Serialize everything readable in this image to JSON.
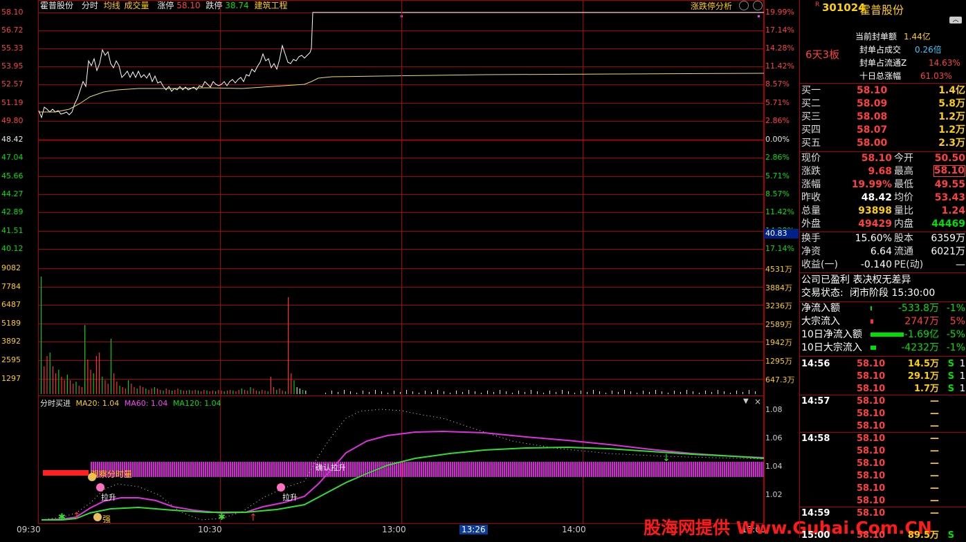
{
  "header": {
    "stock_name": "霍普股份",
    "mode": "分时",
    "avg_label": "均线",
    "vol_label": "成交量",
    "limit_up_label": "涨停",
    "limit_up_value": "58.10",
    "limit_down_label": "跌停",
    "limit_down_value": "38.74",
    "sector": "建筑工程",
    "analysis_button": "涨跌停分析"
  },
  "price_axis_left": [
    "58.10",
    "56.72",
    "55.33",
    "53.95",
    "52.57",
    "51.19",
    "49.80",
    "48.42",
    "47.04",
    "45.66",
    "44.27",
    "42.89",
    "41.51",
    "40.12"
  ],
  "price_axis_right": [
    "19.99%",
    "17.14%",
    "14.28%",
    "11.42%",
    "8.57%",
    "5.71%",
    "2.86%",
    "0.00%",
    "2.86%",
    "5.71%",
    "8.57%",
    "11.42%",
    "14.28%",
    "17.14%"
  ],
  "cursor_price": "40.83",
  "volume_axis_left": [
    "9082",
    "7784",
    "6487",
    "5189",
    "3892",
    "2595",
    "1297"
  ],
  "volume_axis_right": [
    "4531万",
    "3884万",
    "3236万",
    "2589万",
    "1942万",
    "1295万",
    "647.3万"
  ],
  "indicator": {
    "name": "分时买进",
    "ma20_label": "MA20: 1.04",
    "ma60_label": "MA60: 1.04",
    "ma120_label": "MA120: 1.04",
    "axis": [
      "1.08",
      "1.06",
      "1.04",
      "1.02"
    ],
    "annot_observe": "观察分时量",
    "annot_pull1": "拉升",
    "annot_pull2": "拉升",
    "annot_strong": "强",
    "annot_confirm": "确认拉升"
  },
  "time_axis": [
    "09:30",
    "10:30",
    "13:00",
    "13:26",
    "14:00",
    "15:00"
  ],
  "panel": {
    "code": "301024",
    "name": "霍普股份",
    "streak": "6天3板",
    "seal_rows": [
      {
        "label": "当前封单额",
        "value": "1.44亿"
      },
      {
        "label": "封单占成交",
        "value": "0.26倍"
      },
      {
        "label": "封单占流通Z",
        "value": "14.63%"
      },
      {
        "label": "十日总涨幅",
        "value": "61.03%"
      }
    ],
    "bids": [
      {
        "label": "买一",
        "price": "58.10",
        "vol": "1.4亿"
      },
      {
        "label": "买二",
        "price": "58.09",
        "vol": "5.8万"
      },
      {
        "label": "买三",
        "price": "58.08",
        "vol": "1.2万"
      },
      {
        "label": "买四",
        "price": "58.07",
        "vol": "1.2万"
      },
      {
        "label": "买五",
        "price": "58.00",
        "vol": "2.3万"
      }
    ],
    "quote": [
      {
        "l1": "现价",
        "v1": "58.10",
        "l2": "今开",
        "v2": "50.50"
      },
      {
        "l1": "涨跌",
        "v1": "9.68",
        "l2": "最高",
        "v2": "58.10"
      },
      {
        "l1": "涨幅",
        "v1": "19.99%",
        "l2": "最低",
        "v2": "49.55"
      },
      {
        "l1": "昨收",
        "v1": "48.42",
        "l2": "均价",
        "v2": "53.43"
      },
      {
        "l1": "总量",
        "v1": "93898",
        "l2": "量比",
        "v2": "1.24"
      },
      {
        "l1": "外盘",
        "v1": "49429",
        "l2": "内盘",
        "v2": "44469"
      }
    ],
    "stats": [
      {
        "l1": "换手",
        "v1": "15.60%",
        "l2": "股本",
        "v2": "6359万"
      },
      {
        "l1": "净资",
        "v1": "6.64",
        "l2": "流通",
        "v2": "6021万"
      },
      {
        "l1": "收益(一)",
        "v1": "-0.140",
        "l2": "PE(动)",
        "v2": "—"
      }
    ],
    "profit_note": "公司已盈利 表决权无差异",
    "trade_status_label": "交易状态:",
    "trade_status_value": "闭市阶段 15:30:00",
    "flows": [
      {
        "label": "净流入额",
        "value": "-533.8万",
        "pct": "-1%"
      },
      {
        "label": "大宗流入",
        "value": "2747万",
        "pct": "5%"
      },
      {
        "label": "10日净流入额",
        "value": "-1.69亿",
        "pct": "-5%"
      },
      {
        "label": "10日大宗流入",
        "value": "-4232万",
        "pct": "-1%"
      }
    ],
    "ticks": [
      {
        "time": "14:56",
        "price": "58.10",
        "vol": "14.5万",
        "side": "S",
        "n": "1"
      },
      {
        "time": "",
        "price": "58.10",
        "vol": "29.1万",
        "side": "S",
        "n": "1"
      },
      {
        "time": "",
        "price": "58.10",
        "vol": "1.7万",
        "side": "S",
        "n": "1"
      },
      {
        "time": "14:57",
        "price": "58.10",
        "vol": "—",
        "side": "",
        "n": ""
      },
      {
        "time": "",
        "price": "58.10",
        "vol": "—",
        "side": "",
        "n": ""
      },
      {
        "time": "",
        "price": "58.10",
        "vol": "—",
        "side": "",
        "n": ""
      },
      {
        "time": "14:58",
        "price": "58.10",
        "vol": "—",
        "side": "",
        "n": ""
      },
      {
        "time": "",
        "price": "58.10",
        "vol": "—",
        "side": "",
        "n": ""
      },
      {
        "time": "",
        "price": "58.10",
        "vol": "—",
        "side": "",
        "n": ""
      },
      {
        "time": "",
        "price": "58.10",
        "vol": "—",
        "side": "",
        "n": ""
      },
      {
        "time": "",
        "price": "58.10",
        "vol": "—",
        "side": "",
        "n": ""
      },
      {
        "time": "",
        "price": "58.10",
        "vol": "—",
        "side": "",
        "n": ""
      },
      {
        "time": "14:59",
        "price": "58.10",
        "vol": "—",
        "side": "",
        "n": ""
      },
      {
        "time": "15:00",
        "price": "58.10",
        "vol": "89.5万",
        "side": "S",
        "n": ""
      }
    ]
  },
  "watermark": "股海网提供 Www.Guhai.Com.CN",
  "colors": {
    "up": "#ff4040",
    "down": "#00e000",
    "grid": "#a00000",
    "price_line": "#ffffff",
    "avg_line": "#e8e070"
  }
}
